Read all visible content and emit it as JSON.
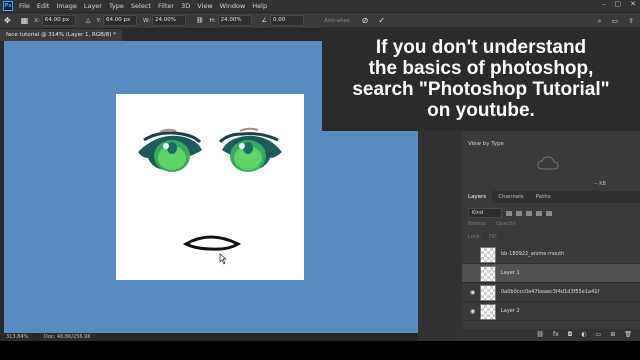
{
  "menubar": {
    "logo": "Ps",
    "items": [
      "File",
      "Edit",
      "Image",
      "Layer",
      "Type",
      "Select",
      "Filter",
      "3D",
      "View",
      "Window",
      "Help"
    ]
  },
  "options": {
    "x_label": "X:",
    "x_value": "64.00 px",
    "y_label": "Y:",
    "y_value": "64.00 px",
    "w_label": "W:",
    "w_value": "24.00%",
    "h_label": "H:",
    "h_value": "24.00%",
    "angle_value": "0.00",
    "antialias": "Anti-alias"
  },
  "document": {
    "tab_title": "face tutorial @ 314% (Layer 1, RGB/8) *"
  },
  "status": {
    "zoom": "313.84%",
    "doc": "Doc: 46.8K/256.9K"
  },
  "overlay": {
    "lines": [
      "If you don't understand",
      "the basics of photoshop,",
      "search \"Photoshop Tutorial\"",
      "on youtube."
    ]
  },
  "panels": {
    "view_by": "View by Type",
    "lib_meta": "-- KB",
    "tabs": [
      "Layers",
      "Channels",
      "Paths"
    ],
    "kind": "Kind",
    "blend_mode": "Normal",
    "opacity_label": "Opacity:",
    "lock_label": "Lock:",
    "fill_label": "Fill:",
    "layers": [
      {
        "name": "bb-180922_anime-mouth",
        "visible": false,
        "selected": false
      },
      {
        "name": "Layer 1",
        "visible": false,
        "selected": true
      },
      {
        "name": "0a0b0ccc0e47beaec3f4d1d3f55e1a41f",
        "visible": true,
        "selected": false
      },
      {
        "name": "Layer 2",
        "visible": true,
        "selected": false
      }
    ]
  },
  "colors": {
    "canvas_bg": "#5a8bbf",
    "eye_green": "#5fd36a",
    "eye_teal": "#1e6a6a"
  }
}
